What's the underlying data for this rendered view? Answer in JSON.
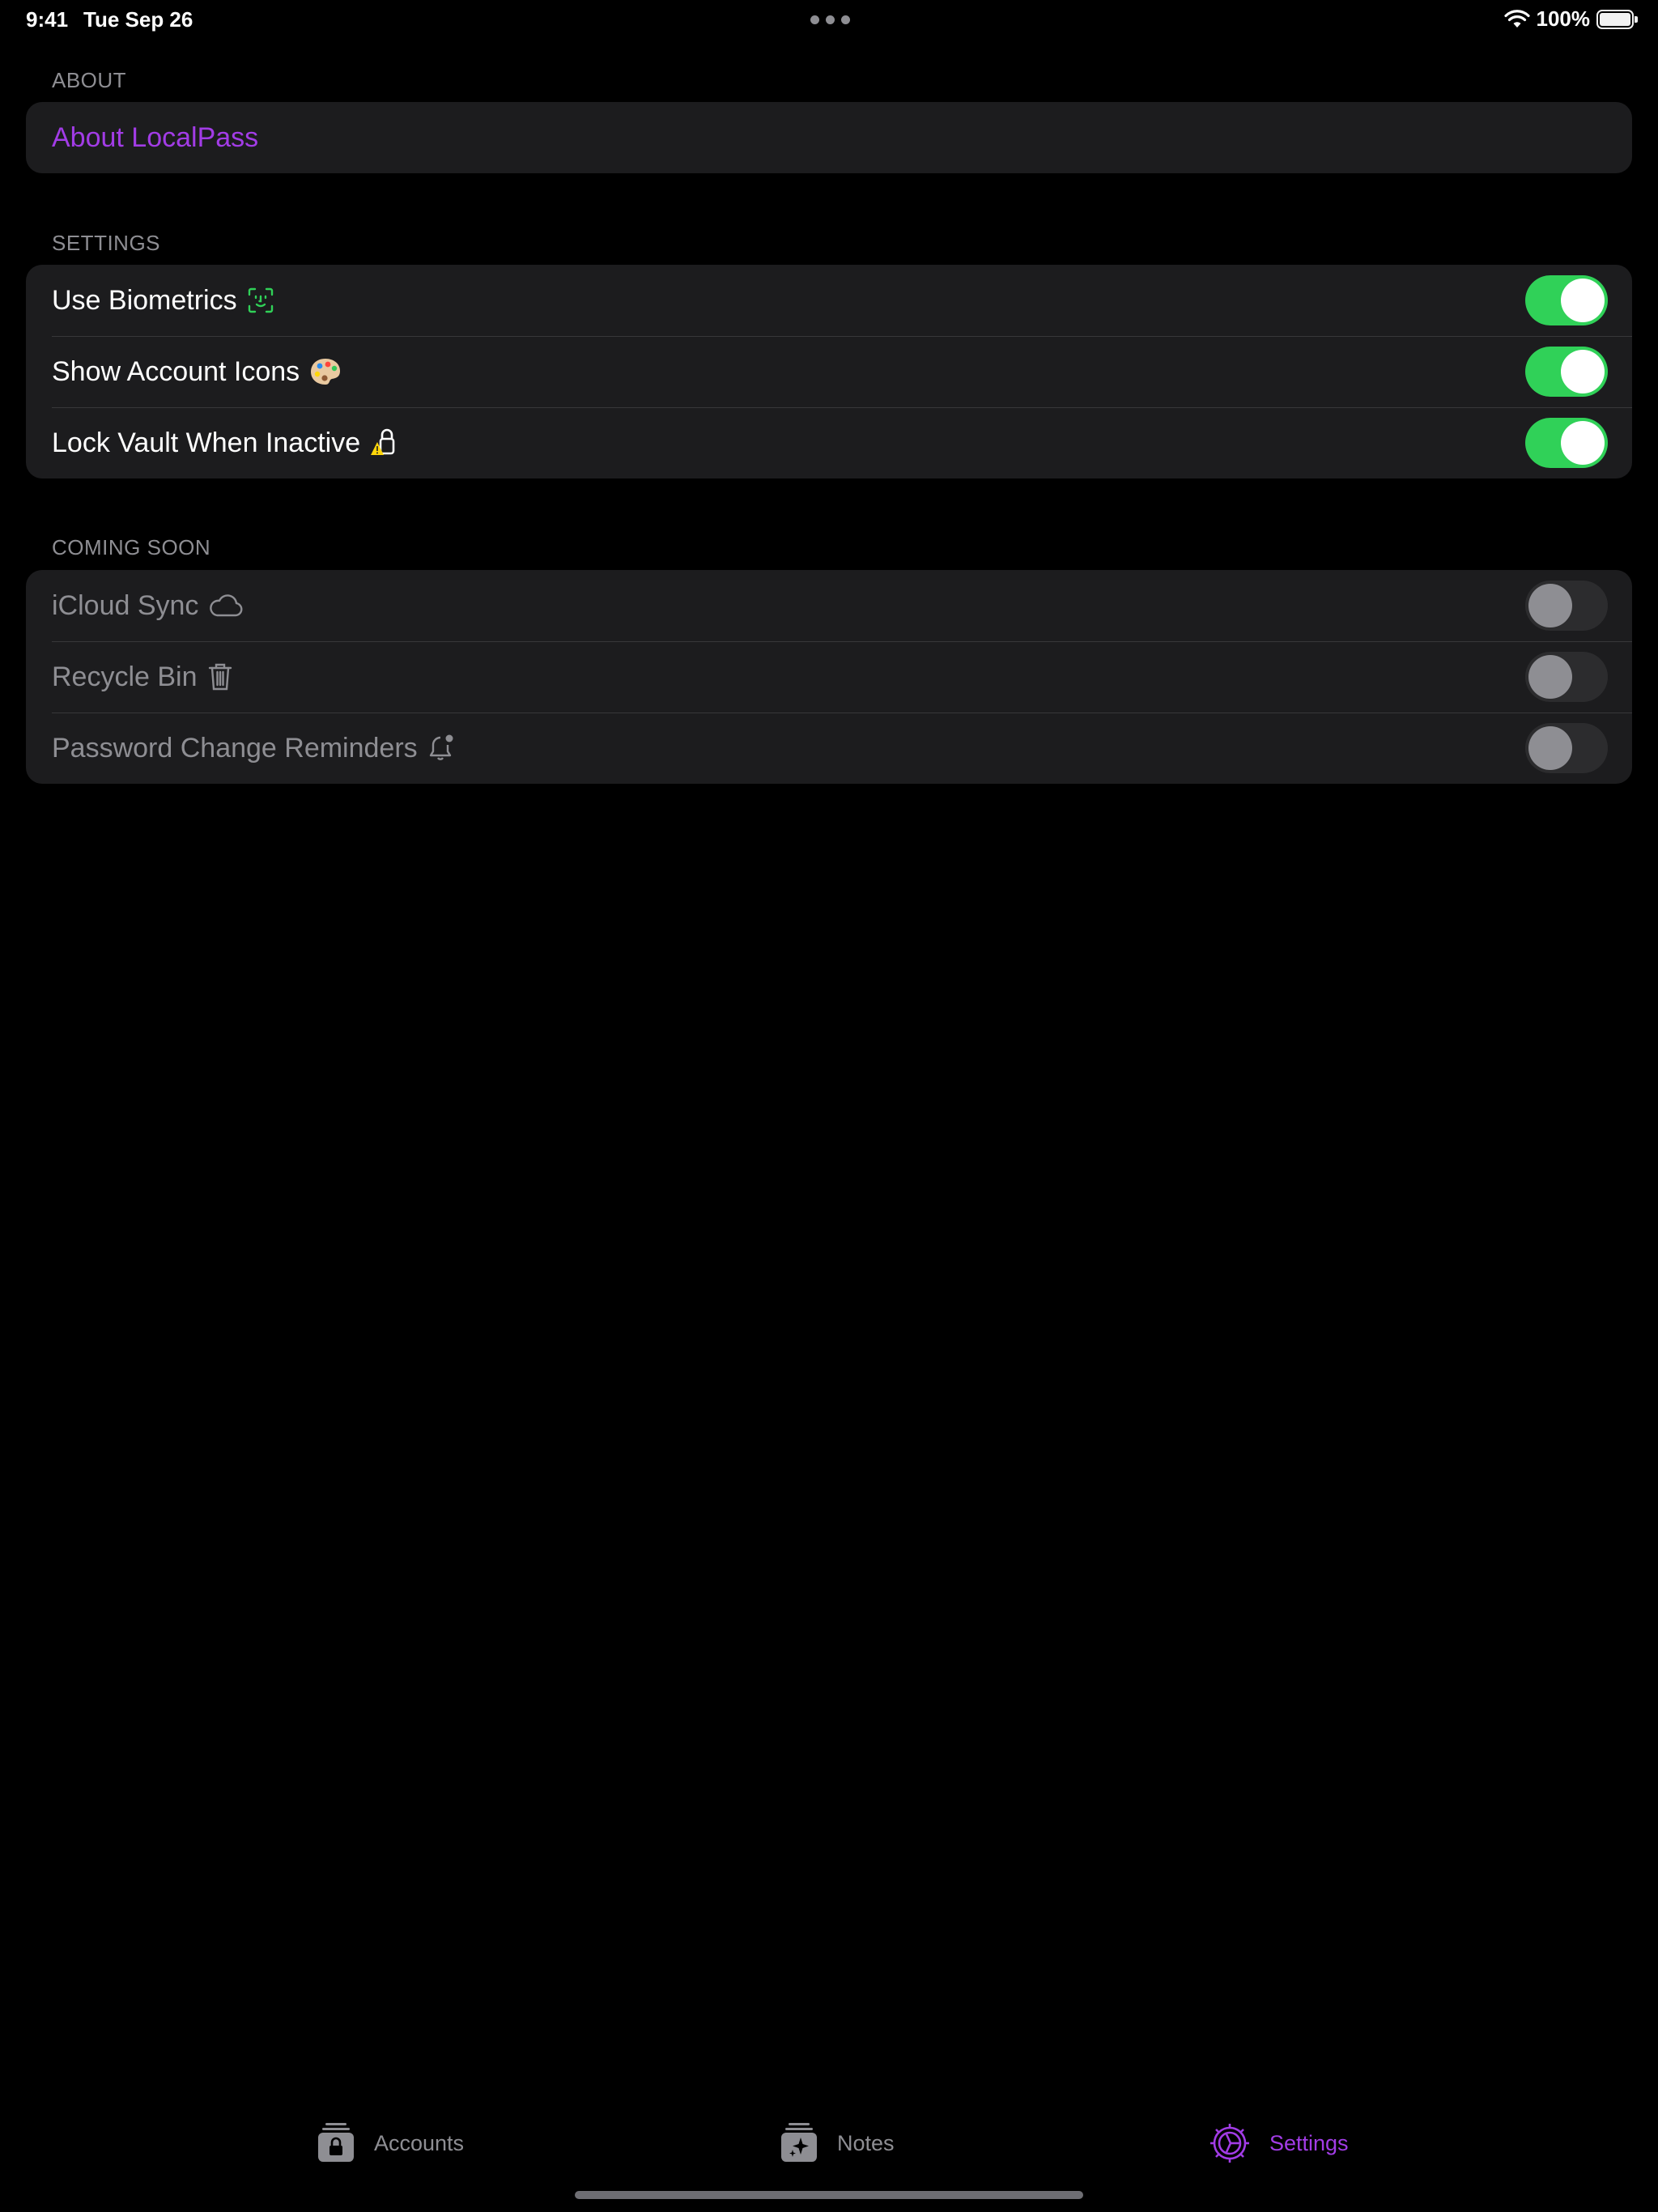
{
  "status_bar": {
    "time": "9:41",
    "date": "Tue Sep 26",
    "battery_percent": "100%",
    "battery_level": 1.0
  },
  "sections": {
    "about": {
      "header": "ABOUT",
      "rows": [
        {
          "label": "About LocalPass"
        }
      ]
    },
    "settings": {
      "header": "SETTINGS",
      "rows": [
        {
          "label": "Use Biometrics",
          "icon": "face-id-icon",
          "enabled": true
        },
        {
          "label": "Show Account Icons",
          "icon": "palette-emoji-icon",
          "enabled": true
        },
        {
          "label": "Lock Vault When Inactive",
          "icon": "lock-warning-icon",
          "enabled": true
        }
      ]
    },
    "coming_soon": {
      "header": "COMING SOON",
      "rows": [
        {
          "label": "iCloud Sync",
          "icon": "cloud-icon",
          "enabled": false
        },
        {
          "label": "Recycle Bin",
          "icon": "trash-icon",
          "enabled": false
        },
        {
          "label": "Password Change Reminders",
          "icon": "bell-badge-icon",
          "enabled": false
        }
      ]
    }
  },
  "tab_bar": {
    "tabs": [
      {
        "label": "Accounts",
        "icon": "lock-stack-icon",
        "active": false
      },
      {
        "label": "Notes",
        "icon": "sparkle-stack-icon",
        "active": false
      },
      {
        "label": "Settings",
        "icon": "gear-icon",
        "active": true
      }
    ]
  },
  "colors": {
    "accent": "#a23ce6",
    "toggle_on": "#30d158",
    "background": "#000000",
    "group_background": "#1c1c1e",
    "secondary_text": "#8e8e93"
  }
}
